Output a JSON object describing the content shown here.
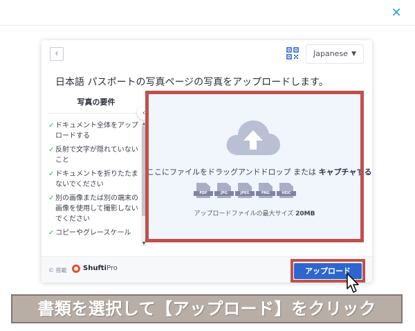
{
  "close_icon": "close-icon",
  "modal": {
    "back_icon": "chevron-left-icon",
    "qr_icon": "qr-code-icon",
    "language": {
      "selected": "Japanese",
      "chevron": "⌄"
    },
    "instruction": "日本語 パスポートの写真ページの写真をアップロードします。",
    "requirements": {
      "title": "写真の要件",
      "items": [
        "ドキュメント全体をアップロードする",
        "反射で文字が隠れていないこと",
        "ドキュメントを折りたたまないでください",
        "別の画像または別の端末の画像を使用して撮影しないでください",
        "コピーやグレースケール"
      ]
    },
    "collapse_glyph": "‹",
    "dropzone": {
      "text_prefix": "ここにファイルをドラッグアンドドロップ または ",
      "text_link": "キャプチャする",
      "file_types": [
        "PDF",
        "JPG",
        "JPEG",
        "PNG",
        "HEIC"
      ],
      "max_size_label": "アップロードファイルの最大サイズ ",
      "max_size_value": "20MB"
    },
    "footer": {
      "powered_by": "© 搭載",
      "brand_bold": "Shufti",
      "brand_light": "Pro"
    },
    "upload_button": "アップロード"
  },
  "caption": "書類を選択して【アップロード】をクリック",
  "colors": {
    "accent": "#2e66cf",
    "highlight": "#c0504d",
    "caption_bg": "#b8aea6",
    "check": "#27ae60"
  }
}
